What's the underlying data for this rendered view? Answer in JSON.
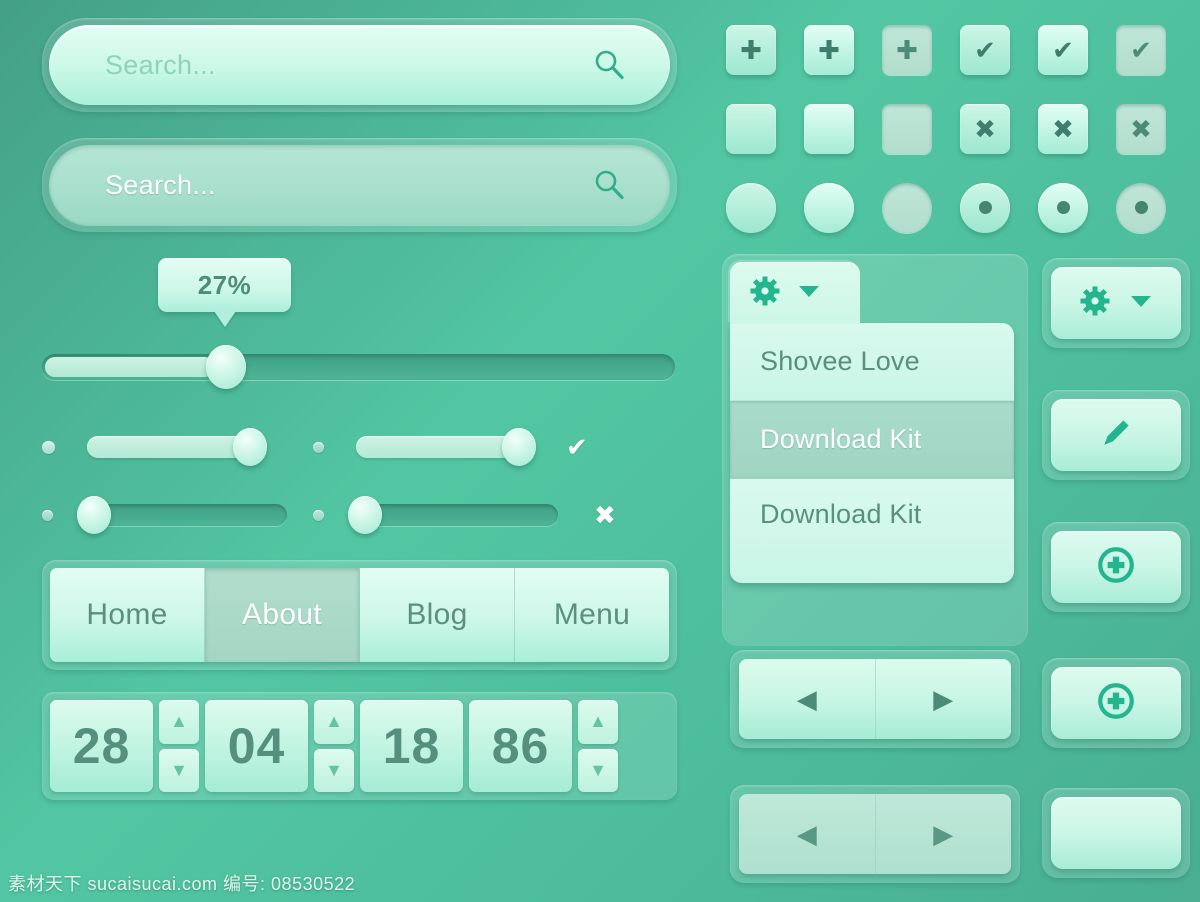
{
  "theme": {
    "background_start": "#44a087",
    "background_mid": "#52c6a2",
    "background_end": "#49ae92",
    "surface_light": "#ddfbef",
    "surface_muted": "#b2ddcd",
    "accent_teal": "#23b58d",
    "text_color": "#55907f"
  },
  "search": {
    "primary": {
      "placeholder": "Search...",
      "icon": "search-icon"
    },
    "secondary": {
      "placeholder": "Search...",
      "icon": "search-icon"
    }
  },
  "slider": {
    "tooltip_value": "27%",
    "fill_percent": 27,
    "toggles": [
      {
        "state": "on",
        "position": "right",
        "end_icon": ""
      },
      {
        "state": "on",
        "position": "right",
        "end_icon": "✔"
      },
      {
        "state": "off",
        "position": "left",
        "end_icon": ""
      },
      {
        "state": "off",
        "position": "left",
        "end_icon": "✖"
      }
    ]
  },
  "nav": {
    "items": [
      {
        "label": "Home",
        "active": false
      },
      {
        "label": "About",
        "active": true
      },
      {
        "label": "Blog",
        "active": false
      },
      {
        "label": "Menu",
        "active": false
      }
    ]
  },
  "steppers": {
    "values": [
      "28",
      "04",
      "18",
      "86"
    ],
    "up_icon": "▲",
    "down_icon": "▼"
  },
  "checkboxes": {
    "rows": [
      {
        "type": "square",
        "glyph": "✚",
        "name": "plus"
      },
      {
        "type": "square",
        "glyph": "",
        "name": "empty"
      },
      {
        "type": "circle",
        "glyph": "",
        "name": "blank-radio"
      }
    ],
    "right_rows": [
      {
        "type": "square",
        "glyph": "✔",
        "name": "check"
      },
      {
        "type": "square",
        "glyph": "✖",
        "name": "cross"
      },
      {
        "type": "circle",
        "glyph": "dot",
        "name": "radio-selected"
      }
    ],
    "variants": [
      "default",
      "hover",
      "disabled"
    ]
  },
  "dropdown": {
    "header_icon": "gear-icon",
    "header_caret": "▼",
    "items": [
      {
        "label": "Shovee Love",
        "highlighted": false
      },
      {
        "label": "Download Kit",
        "highlighted": true
      },
      {
        "label": "Download Kit",
        "highlighted": false
      }
    ]
  },
  "pagers": [
    {
      "state": "bright",
      "prev_icon": "◀",
      "next_icon": "▶"
    },
    {
      "state": "dim",
      "prev_icon": "◀",
      "next_icon": "▶"
    }
  ],
  "icon_buttons": [
    {
      "name": "settings-dropdown-button",
      "icons": [
        "gear-icon",
        "caret-down-icon"
      ]
    },
    {
      "name": "edit-button",
      "icons": [
        "pencil-icon"
      ]
    },
    {
      "name": "add-button-1",
      "icons": [
        "circle-plus-icon"
      ]
    },
    {
      "name": "add-button-2",
      "icons": [
        "circle-plus-icon"
      ]
    },
    {
      "name": "blank-button",
      "icons": []
    }
  ],
  "watermark": {
    "text": "素材天下  sucaisucai.com  编号: 08530522"
  }
}
